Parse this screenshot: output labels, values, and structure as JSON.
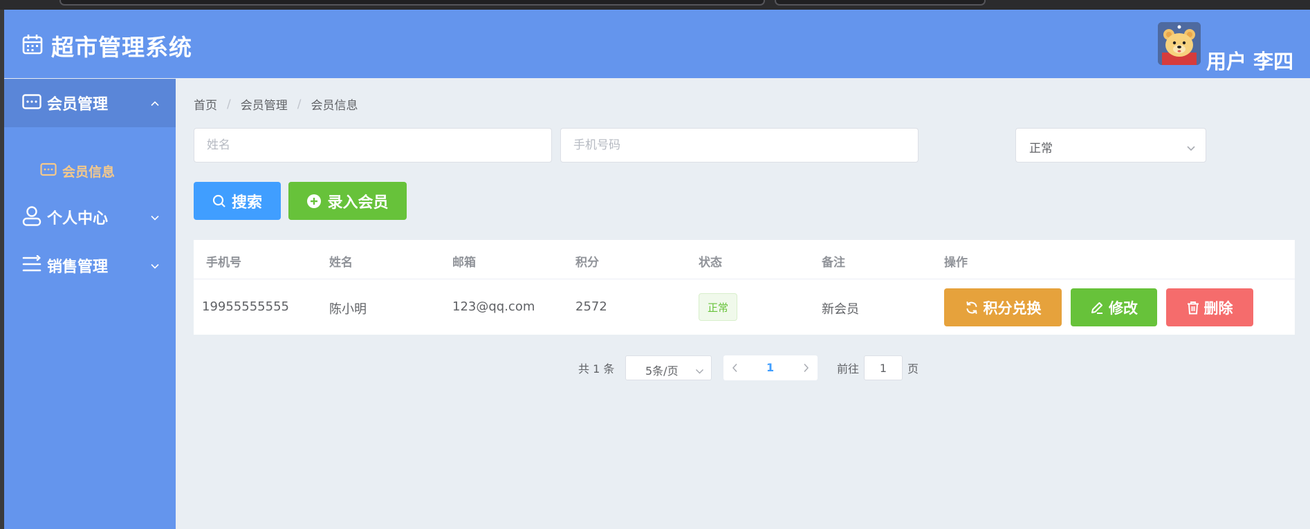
{
  "app": {
    "title": "超市管理系统",
    "title_icon": "calendar-icon"
  },
  "user": {
    "label": "用户 李四",
    "avatar_icon": "bear-avatar"
  },
  "sidebar": {
    "groups": [
      {
        "label": "会员管理",
        "icon": "id-card-icon",
        "expanded": true
      },
      {
        "label": "个人中心",
        "icon": "user-icon",
        "expanded": false
      },
      {
        "label": "销售管理",
        "icon": "list-icon",
        "expanded": false
      }
    ],
    "sub_items": [
      {
        "label": "会员信息",
        "icon": "id-card-icon",
        "active": true
      }
    ]
  },
  "breadcrumb": [
    "首页",
    "会员管理",
    "会员信息"
  ],
  "filters": {
    "name_placeholder": "姓名",
    "phone_placeholder": "手机号码",
    "status_value": "正常"
  },
  "buttons": {
    "search": "搜索",
    "add_member": "录入会员"
  },
  "table": {
    "headers": [
      "手机号",
      "姓名",
      "邮箱",
      "积分",
      "状态",
      "备注",
      "操作"
    ],
    "rows": [
      {
        "phone": "19955555555",
        "name": "陈小明",
        "email": "123@qq.com",
        "points": "2572",
        "status": "正常",
        "note": "新会员"
      }
    ],
    "actions": {
      "exchange": "积分兑换",
      "edit": "修改",
      "delete": "删除"
    }
  },
  "pagination": {
    "total_text": "共 1 条",
    "page_size": "5条/页",
    "current_page": "1",
    "goto_label": "前往",
    "goto_value": "1",
    "goto_unit": "页"
  },
  "colors": {
    "header_bg": "#6495ed",
    "primary": "#409eff",
    "success": "#67c23a",
    "warning": "#e6a23c",
    "danger": "#f56c6c",
    "active_submenu_text": "#f6c98a"
  }
}
